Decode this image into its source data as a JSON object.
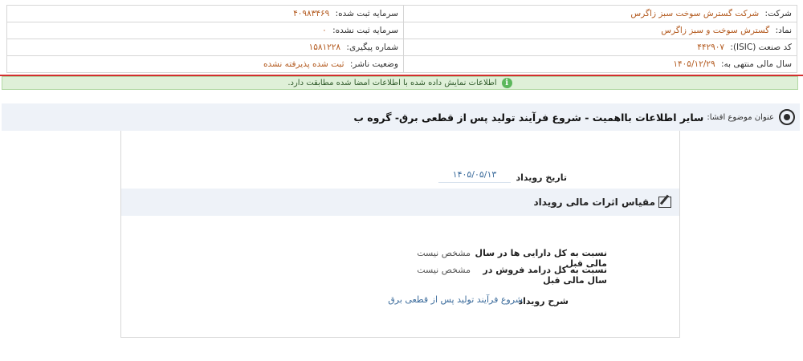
{
  "company_info": {
    "company_label": "شرکت:",
    "company_value": "شرکت گسترش سوخت سبز زاگرس",
    "registered_capital_label": "سرمایه ثبت شده:",
    "registered_capital_value": "۴۰۹۸۳۴۶۹",
    "symbol_label": "نماد:",
    "symbol_value": "گسترش سوخت و سبز زاگرس",
    "unregistered_capital_label": "سرمایه ثبت نشده:",
    "unregistered_capital_value": "۰",
    "isic_label": "کد صنعت (ISIC):",
    "isic_value": "۴۴۲۹۰۷",
    "tracking_label": "شماره پیگیری:",
    "tracking_value": "۱۵۸۱۲۲۸",
    "fiscal_year_label": "سال مالی منتهی به:",
    "fiscal_year_value": "۱۴۰۵/۱۲/۲۹",
    "publisher_status_label": "وضعیت ناشر:",
    "publisher_status_value": "ثبت شده پذیرفته نشده"
  },
  "colors": {
    "value_text": "#b35a1f",
    "divider": "#d32f2f",
    "notice_bg": "#dff0d8",
    "bar_bg": "#eef2f8"
  },
  "notice": {
    "icon": "info-icon",
    "text": "اطلاعات نمایش داده شده با اطلاعات امضا شده مطابقت دارد."
  },
  "subject": {
    "icon": "target-icon",
    "label": "عنوان موضوع افشا:",
    "title": "سایر اطلاعات بااهمیت - شروع فرآیند تولید پس از قطعی برق- گروه ب"
  },
  "event": {
    "date_label": "تاریخ رویداد",
    "date_value": "۱۴۰۵/۰۵/۱۳"
  },
  "financial_effects": {
    "icon": "edit-icon",
    "title": "مقیاس اثرات مالی رویداد",
    "rows": [
      {
        "label": "نسبت به کل دارایی ها در سال مالی قبل",
        "value": "مشخص نیست"
      },
      {
        "label": "نسبت به کل درامد فروش در سال مالی قبل",
        "value": "مشخص نیست"
      }
    ]
  },
  "description": {
    "label": "شرح رویداد",
    "value": "شروع فرآیند تولید پس از قطعی برق"
  }
}
